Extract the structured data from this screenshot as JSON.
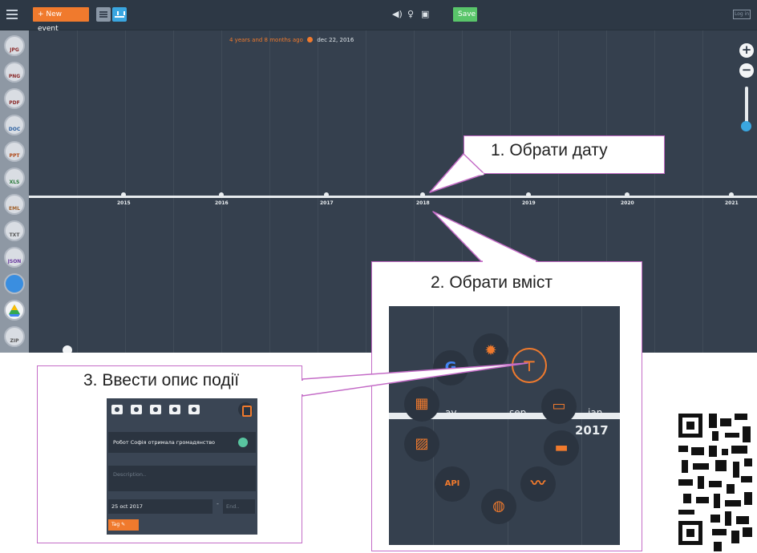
{
  "toolbar": {
    "new_event_label": "+ New event",
    "save_label": "Save",
    "login_label": "Log in"
  },
  "status": {
    "ago_text": "4 years and 8 months ago",
    "date_text": "dec 22, 2016"
  },
  "sidebar": {
    "items": [
      "JPG",
      "PNG",
      "PDF",
      "DOC",
      "PPT",
      "XLS",
      "EML",
      "TXT",
      "JSON",
      "Dropbox",
      "Google Drive",
      "ZIP"
    ]
  },
  "timeline": {
    "years": [
      "2015",
      "2016",
      "2017",
      "2018",
      "2019",
      "2020",
      "2021"
    ]
  },
  "callouts": {
    "step1": "1. Обрати дату",
    "step2": "2. Обрати вміст",
    "step3": "3. Ввести опис події"
  },
  "content_wheel": {
    "months": [
      "ay",
      "sep",
      "jan"
    ],
    "year": "2017",
    "options": [
      "google-icon",
      "virus-icon",
      "sign-icon",
      "rectangle-icon",
      "toggle-icon",
      "line-chart-icon",
      "globe-icon",
      "api-icon",
      "map-icon",
      "chart-image-icon"
    ]
  },
  "event_form": {
    "title_value": "Робот Софія отримала громадянство",
    "description_placeholder": "Description..",
    "start_date": "25 oct 2017",
    "end_placeholder": "End..",
    "tag_label": "Tag"
  },
  "colors": {
    "accent": "#f07a2d",
    "save": "#59c56a",
    "callout_border": "#c46cc7"
  }
}
